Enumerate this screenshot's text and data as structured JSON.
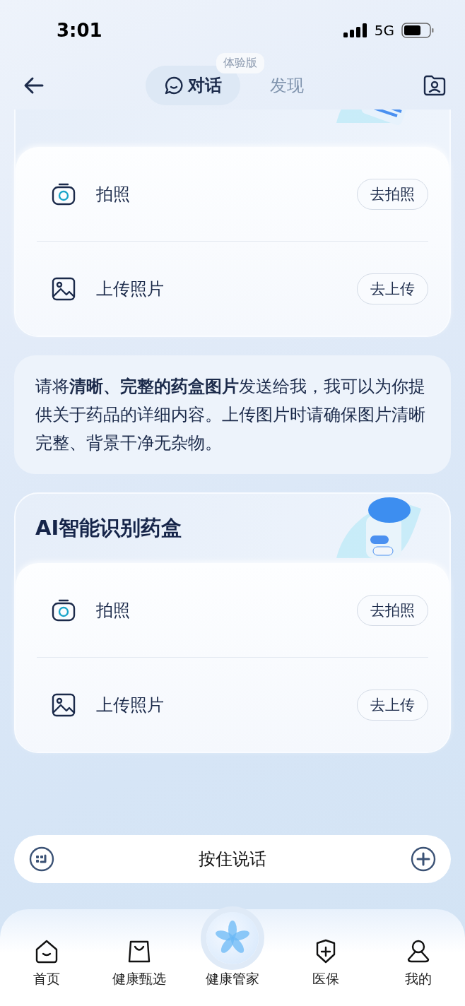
{
  "status_bar": {
    "time": "3:01",
    "network": "5G"
  },
  "header": {
    "tabs": [
      {
        "label": "对话",
        "selected": true
      },
      {
        "label": "发现",
        "selected": false,
        "badge": "体验版"
      }
    ]
  },
  "feed": [
    {
      "kind": "report_card",
      "actions": [
        {
          "kind": "camera",
          "label": "拍照",
          "button": "去拍照"
        },
        {
          "kind": "image",
          "label": "上传照片",
          "button": "去上传"
        }
      ]
    },
    {
      "kind": "message",
      "text": "请将**清晰、完整的药盒图片**发送给我，我可以为你提供关于药品的详细内容。上传图片时请确保图片清晰完整、背景干净无杂物。"
    },
    {
      "kind": "medicine_card",
      "title": "AI智能识别药盒",
      "actions": [
        {
          "kind": "camera",
          "label": "拍照",
          "button": "去拍照"
        },
        {
          "kind": "image",
          "label": "上传照片",
          "button": "去上传"
        }
      ]
    }
  ],
  "voice_input": {
    "label": "按住说话"
  },
  "nav": [
    {
      "kind": "home",
      "label": "首页"
    },
    {
      "kind": "bag",
      "label": "健康甄选"
    },
    {
      "kind": "orb",
      "label": "健康管家"
    },
    {
      "kind": "shield",
      "label": "医保"
    },
    {
      "kind": "person",
      "label": "我的"
    }
  ]
}
